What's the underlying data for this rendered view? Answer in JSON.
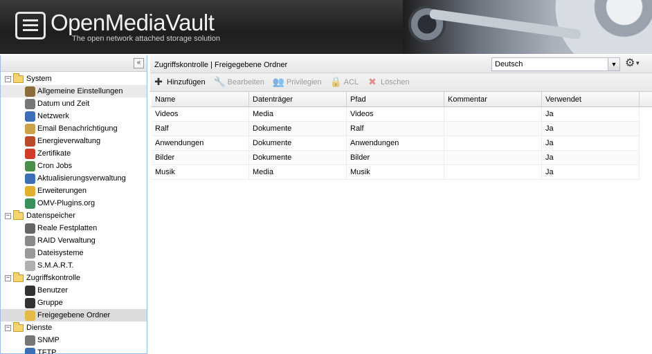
{
  "header": {
    "title": "OpenMediaVault",
    "subtitle": "The open network attached storage solution"
  },
  "sidebar": {
    "collapse_icon": "double-chevron-left-icon",
    "tree": [
      {
        "label": "System",
        "type": "folder",
        "level": 0,
        "expanded": true
      },
      {
        "label": "Allgemeine Einstellungen",
        "type": "leaf",
        "icon": "tools-icon",
        "icon_color": "#8a6d3b"
      },
      {
        "label": "Datum und Zeit",
        "type": "leaf",
        "icon": "clock-icon",
        "icon_color": "#777777"
      },
      {
        "label": "Netzwerk",
        "type": "leaf",
        "icon": "network-icon",
        "icon_color": "#3b6fb6"
      },
      {
        "label": "Email Benachrichtigung",
        "type": "leaf",
        "icon": "email-icon",
        "icon_color": "#c9a24a"
      },
      {
        "label": "Energieverwaltung",
        "type": "leaf",
        "icon": "power-plug-icon",
        "icon_color": "#b94a2c"
      },
      {
        "label": "Zertifikate",
        "type": "leaf",
        "icon": "certificate-icon",
        "icon_color": "#d23a2a"
      },
      {
        "label": "Cron Jobs",
        "type": "leaf",
        "icon": "cron-icon",
        "icon_color": "#4a8f4a"
      },
      {
        "label": "Aktualisierungsverwaltung",
        "type": "leaf",
        "icon": "update-icon",
        "icon_color": "#3b6fb6"
      },
      {
        "label": "Erweiterungen",
        "type": "leaf",
        "icon": "puzzle-icon",
        "icon_color": "#e0b030"
      },
      {
        "label": "OMV-Plugins.org",
        "type": "leaf",
        "icon": "globe-icon",
        "icon_color": "#3a8f5a"
      },
      {
        "label": "Datenspeicher",
        "type": "folder",
        "level": 0,
        "expanded": true
      },
      {
        "label": "Reale Festplatten",
        "type": "leaf",
        "icon": "disk-icon",
        "icon_color": "#666666"
      },
      {
        "label": "RAID Verwaltung",
        "type": "leaf",
        "icon": "raid-icon",
        "icon_color": "#8a8a8a"
      },
      {
        "label": "Dateisysteme",
        "type": "leaf",
        "icon": "filesystem-icon",
        "icon_color": "#9a9a9a"
      },
      {
        "label": "S.M.A.R.T.",
        "type": "leaf",
        "icon": "smart-icon",
        "icon_color": "#b0b0b0"
      },
      {
        "label": "Zugriffskontrolle",
        "type": "folder",
        "level": 0,
        "expanded": true
      },
      {
        "label": "Benutzer",
        "type": "leaf",
        "icon": "user-icon",
        "icon_color": "#333333"
      },
      {
        "label": "Gruppe",
        "type": "leaf",
        "icon": "group-icon",
        "icon_color": "#333333"
      },
      {
        "label": "Freigegebene Ordner",
        "type": "leaf",
        "icon": "shared-folder-icon",
        "icon_color": "#e6b84a",
        "selected": true
      },
      {
        "label": "Dienste",
        "type": "folder",
        "level": 0,
        "expanded": true
      },
      {
        "label": "SNMP",
        "type": "leaf",
        "icon": "snmp-icon",
        "icon_color": "#777777"
      },
      {
        "label": "TFTP",
        "type": "leaf",
        "icon": "tftp-icon",
        "icon_color": "#3b6fb6"
      }
    ]
  },
  "main": {
    "breadcrumb": "Zugriffskontrolle | Freigegebene Ordner",
    "language": {
      "selected": "Deutsch"
    },
    "toolbar": [
      {
        "label": "Hinzufügen",
        "icon": "plus-icon",
        "glyph": "✚",
        "disabled": false
      },
      {
        "label": "Bearbeiten",
        "icon": "wrench-icon",
        "glyph": "🔧",
        "disabled": true
      },
      {
        "label": "Privilegien",
        "icon": "privileges-icon",
        "glyph": "👥",
        "disabled": true
      },
      {
        "label": "ACL",
        "icon": "acl-icon",
        "glyph": "🔒",
        "disabled": true
      },
      {
        "label": "Löschen",
        "icon": "delete-icon",
        "glyph": "✖",
        "disabled": true
      }
    ],
    "grid": {
      "columns": [
        "Name",
        "Datenträger",
        "Pfad",
        "Kommentar",
        "Verwendet"
      ],
      "rows": [
        [
          "Videos",
          "Media",
          "Videos",
          "",
          "Ja"
        ],
        [
          "Ralf",
          "Dokumente",
          "Ralf",
          "",
          "Ja"
        ],
        [
          "Anwendungen",
          "Dokumente",
          "Anwendungen",
          "",
          "Ja"
        ],
        [
          "Bilder",
          "Dokumente",
          "Bilder",
          "",
          "Ja"
        ],
        [
          "Musik",
          "Media",
          "Musik",
          "",
          "Ja"
        ]
      ]
    }
  }
}
